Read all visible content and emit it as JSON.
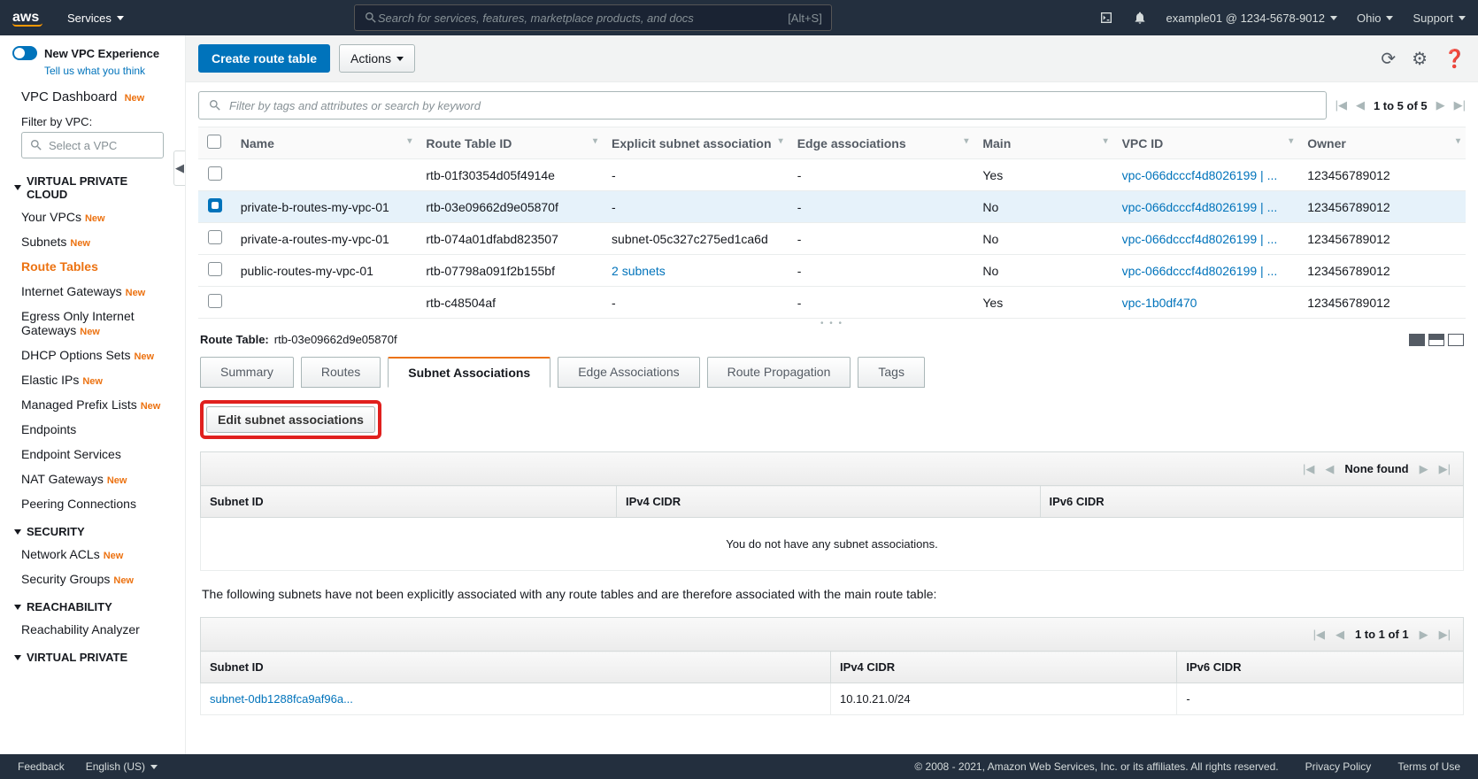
{
  "topnav": {
    "services": "Services",
    "search_placeholder": "Search for services, features, marketplace products, and docs",
    "search_shortcut": "[Alt+S]",
    "account": "example01 @ 1234-5678-9012",
    "region": "Ohio",
    "support": "Support"
  },
  "sidebar": {
    "new_experience": "New VPC Experience",
    "tell_us": "Tell us what you think",
    "dashboard": "VPC Dashboard",
    "filter_label": "Filter by VPC:",
    "filter_placeholder": "Select a VPC",
    "groups": [
      {
        "title": "VIRTUAL PRIVATE CLOUD",
        "items": [
          {
            "label": "Your VPCs",
            "new": true
          },
          {
            "label": "Subnets",
            "new": true
          },
          {
            "label": "Route Tables",
            "new": false,
            "active": true
          },
          {
            "label": "Internet Gateways",
            "new": true
          },
          {
            "label": "Egress Only Internet Gateways",
            "new": true
          },
          {
            "label": "DHCP Options Sets",
            "new": true
          },
          {
            "label": "Elastic IPs",
            "new": true
          },
          {
            "label": "Managed Prefix Lists",
            "new": true
          },
          {
            "label": "Endpoints",
            "new": false
          },
          {
            "label": "Endpoint Services",
            "new": false
          },
          {
            "label": "NAT Gateways",
            "new": true
          },
          {
            "label": "Peering Connections",
            "new": false
          }
        ]
      },
      {
        "title": "SECURITY",
        "items": [
          {
            "label": "Network ACLs",
            "new": true
          },
          {
            "label": "Security Groups",
            "new": true
          }
        ]
      },
      {
        "title": "REACHABILITY",
        "items": [
          {
            "label": "Reachability Analyzer",
            "new": false
          }
        ]
      },
      {
        "title": "VIRTUAL PRIVATE",
        "items": []
      }
    ]
  },
  "actions": {
    "create": "Create route table",
    "actions": "Actions"
  },
  "filter": {
    "placeholder": "Filter by tags and attributes or search by keyword",
    "range": "1 to 5 of 5"
  },
  "table": {
    "headers": [
      "Name",
      "Route Table ID",
      "Explicit subnet association",
      "Edge associations",
      "Main",
      "VPC ID",
      "Owner"
    ],
    "rows": [
      {
        "checked": false,
        "name": "",
        "rtid": "rtb-01f30354d05f4914e",
        "subnet": "-",
        "edge": "-",
        "main": "Yes",
        "vpc": "vpc-066dcccf4d8026199 | ...",
        "owner": "123456789012"
      },
      {
        "checked": true,
        "name": "private-b-routes-my-vpc-01",
        "rtid": "rtb-03e09662d9e05870f",
        "subnet": "-",
        "edge": "-",
        "main": "No",
        "vpc": "vpc-066dcccf4d8026199 | ...",
        "owner": "123456789012"
      },
      {
        "checked": false,
        "name": "private-a-routes-my-vpc-01",
        "rtid": "rtb-074a01dfabd823507",
        "subnet": "subnet-05c327c275ed1ca6d",
        "edge": "-",
        "main": "No",
        "vpc": "vpc-066dcccf4d8026199 | ...",
        "owner": "123456789012"
      },
      {
        "checked": false,
        "name": "public-routes-my-vpc-01",
        "rtid": "rtb-07798a091f2b155bf",
        "subnet_link": "2 subnets",
        "edge": "-",
        "main": "No",
        "vpc": "vpc-066dcccf4d8026199 | ...",
        "owner": "123456789012"
      },
      {
        "checked": false,
        "name": "",
        "rtid": "rtb-c48504af",
        "subnet": "-",
        "edge": "-",
        "main": "Yes",
        "vpc": "vpc-1b0df470",
        "owner": "123456789012"
      }
    ]
  },
  "detail": {
    "title_label": "Route Table:",
    "title_value": "rtb-03e09662d9e05870f",
    "tabs": [
      "Summary",
      "Routes",
      "Subnet Associations",
      "Edge Associations",
      "Route Propagation",
      "Tags"
    ],
    "edit_btn": "Edit subnet associations",
    "none_found": "None found",
    "assoc_headers": [
      "Subnet ID",
      "IPv4 CIDR",
      "IPv6 CIDR"
    ],
    "empty_msg": "You do not have any subnet associations.",
    "note": "The following subnets have not been explicitly associated with any route tables and are therefore associated with the main route table:",
    "sub_range": "1 to 1 of 1",
    "sub_rows": [
      {
        "subnet": "subnet-0db1288fca9af96a...",
        "ipv4": "10.10.21.0/24",
        "ipv6": "-"
      }
    ]
  },
  "footer": {
    "feedback": "Feedback",
    "lang": "English (US)",
    "copyright": "© 2008 - 2021, Amazon Web Services, Inc. or its affiliates. All rights reserved.",
    "privacy": "Privacy Policy",
    "terms": "Terms of Use"
  },
  "labels": {
    "new": "New"
  }
}
